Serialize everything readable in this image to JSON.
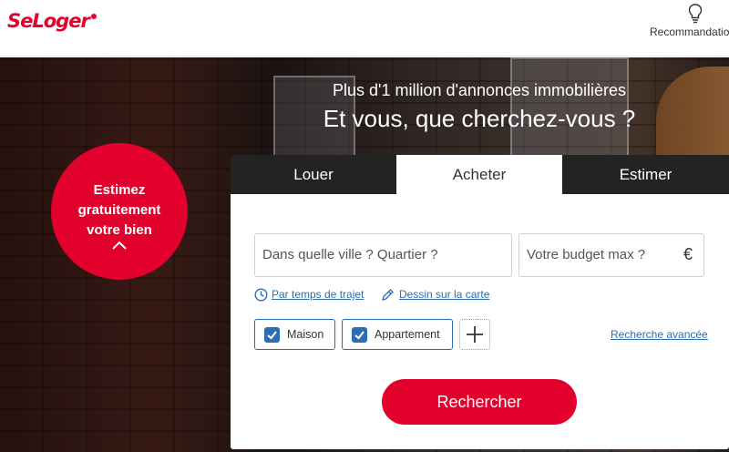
{
  "header": {
    "logo": "SeLoger",
    "recommendations_label": "Recommandatio",
    "recommendations_icon": "lightbulb-icon"
  },
  "hero": {
    "subtitle": "Plus d'1 million d'annonces immobilières",
    "title": "Et vous, que cherchez-vous ?",
    "estimate_cta": {
      "lines": [
        "Estimez",
        "gratuitement",
        "votre bien"
      ],
      "icon": "chevron-up-icon"
    }
  },
  "tabs": [
    {
      "label": "Louer",
      "active": false
    },
    {
      "label": "Acheter",
      "active": true
    },
    {
      "label": "Estimer",
      "active": false
    }
  ],
  "search": {
    "location_placeholder": "Dans quelle ville ? Quartier ?",
    "budget_placeholder": "Votre budget max ?",
    "currency_symbol": "€",
    "travel_time_link": "Par temps de trajet",
    "draw_map_link": "Dessin sur la carte",
    "property_types": [
      {
        "label": "Maison",
        "checked": true
      },
      {
        "label": "Appartement",
        "checked": true
      }
    ],
    "add_type_icon": "plus-icon",
    "advanced_search_link": "Recherche avancée",
    "submit_label": "Rechercher"
  },
  "colors": {
    "brand": "#e2002c",
    "link": "#2a6fb3",
    "tab_bar": "#232323"
  }
}
